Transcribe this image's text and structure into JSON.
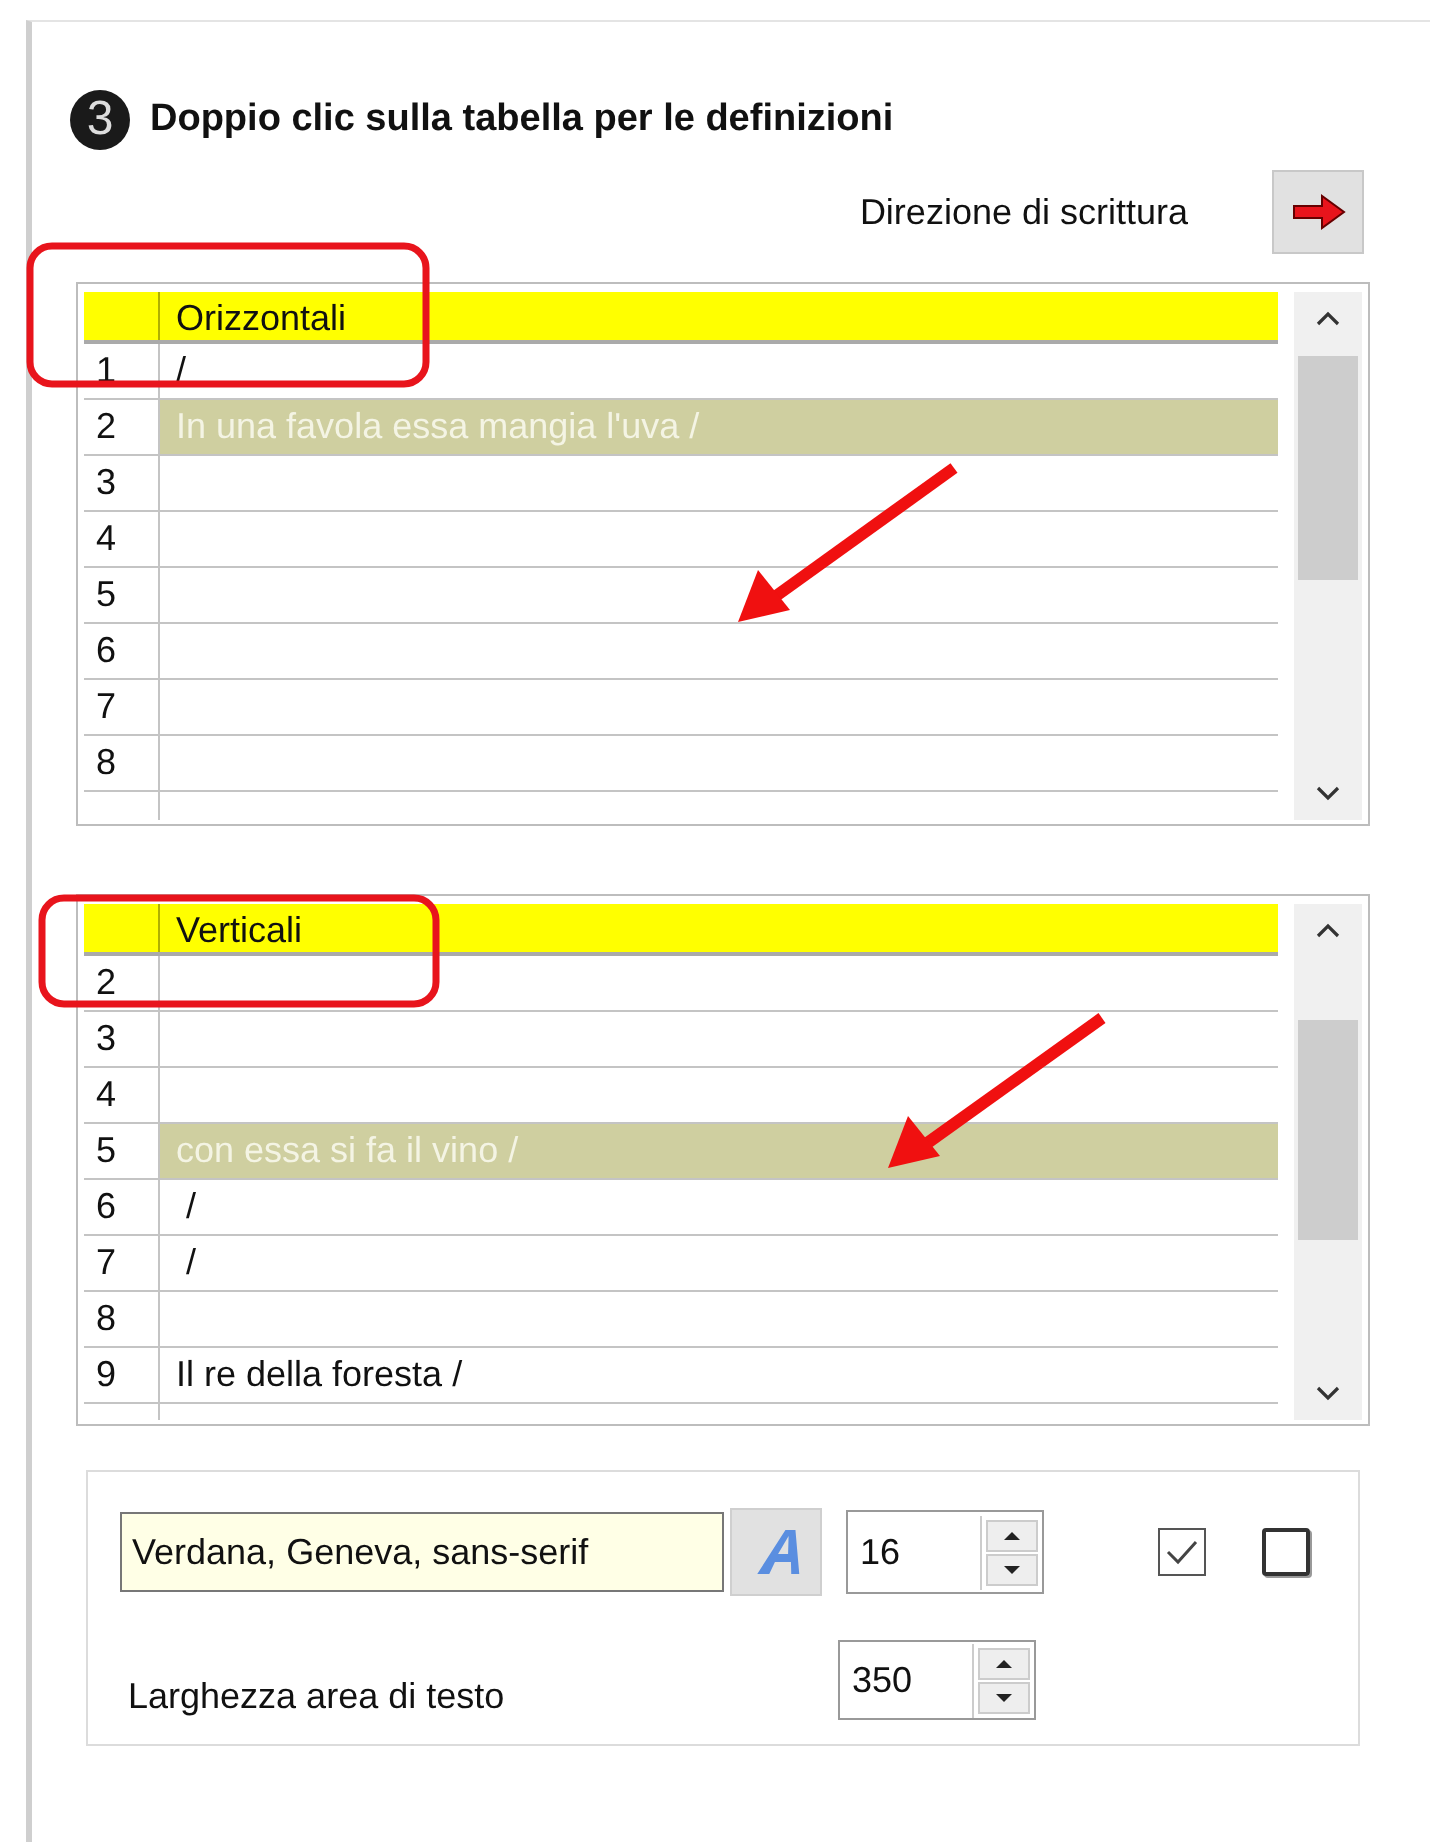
{
  "section": {
    "badge": "3",
    "title": "Doppio clic sulla tabella per le definizioni"
  },
  "direction": {
    "label": "Direzione di scrittura"
  },
  "tables": [
    {
      "header": "Orizzontali",
      "rows": [
        {
          "number": "1",
          "text": "/",
          "selected": false
        },
        {
          "number": "2",
          "text": "In una favola essa mangia l'uva /",
          "selected": true
        },
        {
          "number": "3",
          "text": "",
          "selected": false
        },
        {
          "number": "4",
          "text": "",
          "selected": false
        },
        {
          "number": "5",
          "text": "",
          "selected": false
        },
        {
          "number": "6",
          "text": "",
          "selected": false
        },
        {
          "number": "7",
          "text": "",
          "selected": false
        },
        {
          "number": "8",
          "text": "",
          "selected": false
        }
      ]
    },
    {
      "header": "Verticali",
      "rows": [
        {
          "number": "2",
          "text": "",
          "selected": false
        },
        {
          "number": "3",
          "text": "",
          "selected": false
        },
        {
          "number": "4",
          "text": "",
          "selected": false
        },
        {
          "number": "5",
          "text": "con essa si fa il vino /",
          "selected": true
        },
        {
          "number": "6",
          "text": " /",
          "selected": false
        },
        {
          "number": "7",
          "text": " /",
          "selected": false
        },
        {
          "number": "8",
          "text": "",
          "selected": false
        },
        {
          "number": "9",
          "text": "Il re della foresta /",
          "selected": false
        }
      ]
    }
  ],
  "font": {
    "value": "Verdana, Geneva, sans-serif",
    "size": "16"
  },
  "checkboxes": [
    {
      "checked": true
    },
    {
      "checked": false
    }
  ],
  "text_width": {
    "label": "Larghezza area di testo",
    "value": "350"
  }
}
